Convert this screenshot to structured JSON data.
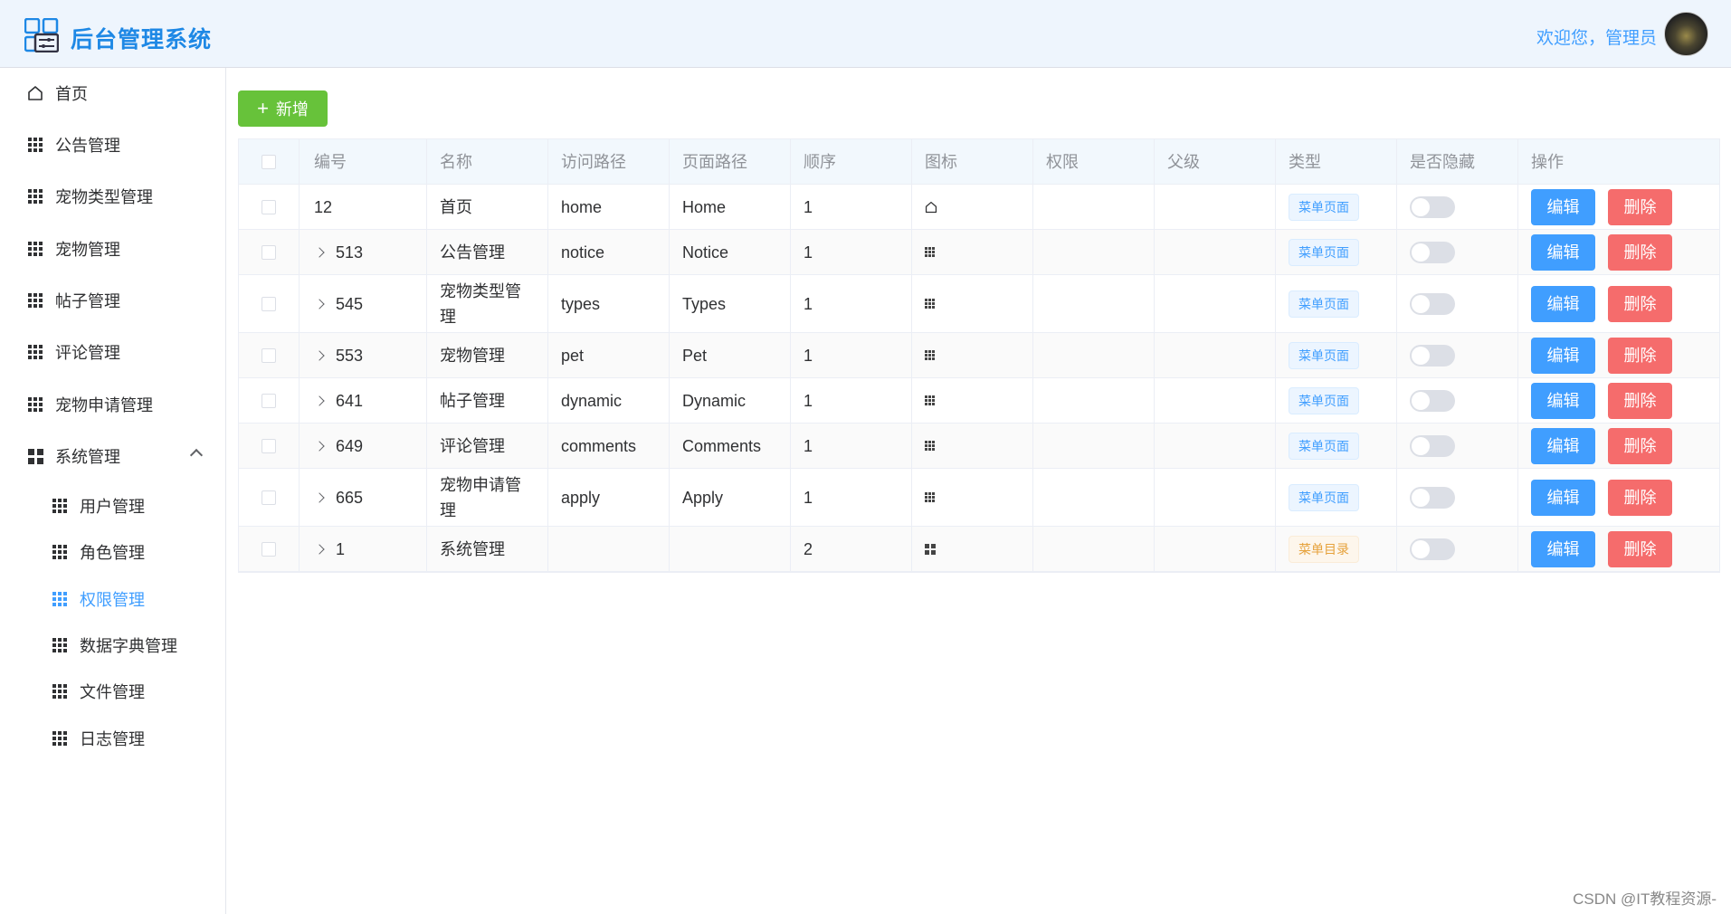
{
  "header": {
    "app_title": "后台管理系统",
    "welcome": "欢迎您，管理员",
    "logo_icon": "dashboard-icon",
    "brand_color": "#1e88e5"
  },
  "sidebar": {
    "items": [
      {
        "label": "首页",
        "icon": "home-icon"
      },
      {
        "label": "公告管理",
        "icon": "grid-icon"
      },
      {
        "label": "宠物类型管理",
        "icon": "grid-icon"
      },
      {
        "label": "宠物管理",
        "icon": "grid-icon"
      },
      {
        "label": "帖子管理",
        "icon": "grid-icon"
      },
      {
        "label": "评论管理",
        "icon": "grid-icon"
      },
      {
        "label": "宠物申请管理",
        "icon": "grid-icon"
      },
      {
        "label": "系统管理",
        "icon": "menu-icon",
        "expanded": true
      }
    ],
    "sub_items": [
      {
        "label": "用户管理",
        "icon": "grid-icon"
      },
      {
        "label": "角色管理",
        "icon": "grid-icon"
      },
      {
        "label": "权限管理",
        "icon": "grid-icon",
        "active": true
      },
      {
        "label": "数据字典管理",
        "icon": "grid-icon"
      },
      {
        "label": "文件管理",
        "icon": "grid-icon"
      },
      {
        "label": "日志管理",
        "icon": "grid-icon"
      }
    ],
    "active_color": "#409eff"
  },
  "toolbar": {
    "add_label": "新增",
    "add_color": "#67c23a"
  },
  "table": {
    "headers": [
      "编号",
      "名称",
      "访问路径",
      "页面路径",
      "顺序",
      "图标",
      "权限",
      "父级",
      "类型",
      "是否隐藏",
      "操作"
    ],
    "edit_label": "编辑",
    "delete_label": "删除",
    "rows": [
      {
        "id": "12",
        "name": "首页",
        "path": "home",
        "page": "Home",
        "order": "1",
        "icon": "home-icon",
        "perm": "",
        "parent": "",
        "type": "菜单页面",
        "type_kind": "page",
        "hidden": false,
        "expandable": false
      },
      {
        "id": "513",
        "name": "公告管理",
        "path": "notice",
        "page": "Notice",
        "order": "1",
        "icon": "grid-icon",
        "perm": "",
        "parent": "",
        "type": "菜单页面",
        "type_kind": "page",
        "hidden": false,
        "expandable": true
      },
      {
        "id": "545",
        "name": "宠物类型管理",
        "path": "types",
        "page": "Types",
        "order": "1",
        "icon": "grid-icon",
        "perm": "",
        "parent": "",
        "type": "菜单页面",
        "type_kind": "page",
        "hidden": false,
        "expandable": true
      },
      {
        "id": "553",
        "name": "宠物管理",
        "path": "pet",
        "page": "Pet",
        "order": "1",
        "icon": "grid-icon",
        "perm": "",
        "parent": "",
        "type": "菜单页面",
        "type_kind": "page",
        "hidden": false,
        "expandable": true
      },
      {
        "id": "641",
        "name": "帖子管理",
        "path": "dynamic",
        "page": "Dynamic",
        "order": "1",
        "icon": "grid-icon",
        "perm": "",
        "parent": "",
        "type": "菜单页面",
        "type_kind": "page",
        "hidden": false,
        "expandable": true
      },
      {
        "id": "649",
        "name": "评论管理",
        "path": "comments",
        "page": "Comments",
        "order": "1",
        "icon": "grid-icon",
        "perm": "",
        "parent": "",
        "type": "菜单页面",
        "type_kind": "page",
        "hidden": false,
        "expandable": true
      },
      {
        "id": "665",
        "name": "宠物申请管理",
        "path": "apply",
        "page": "Apply",
        "order": "1",
        "icon": "grid-icon",
        "perm": "",
        "parent": "",
        "type": "菜单页面",
        "type_kind": "page",
        "hidden": false,
        "expandable": true
      },
      {
        "id": "1",
        "name": "系统管理",
        "path": "",
        "page": "",
        "order": "2",
        "icon": "menu-icon",
        "perm": "",
        "parent": "",
        "type": "菜单目录",
        "type_kind": "dir",
        "hidden": false,
        "expandable": true
      }
    ]
  },
  "watermark": "CSDN @IT教程资源-"
}
